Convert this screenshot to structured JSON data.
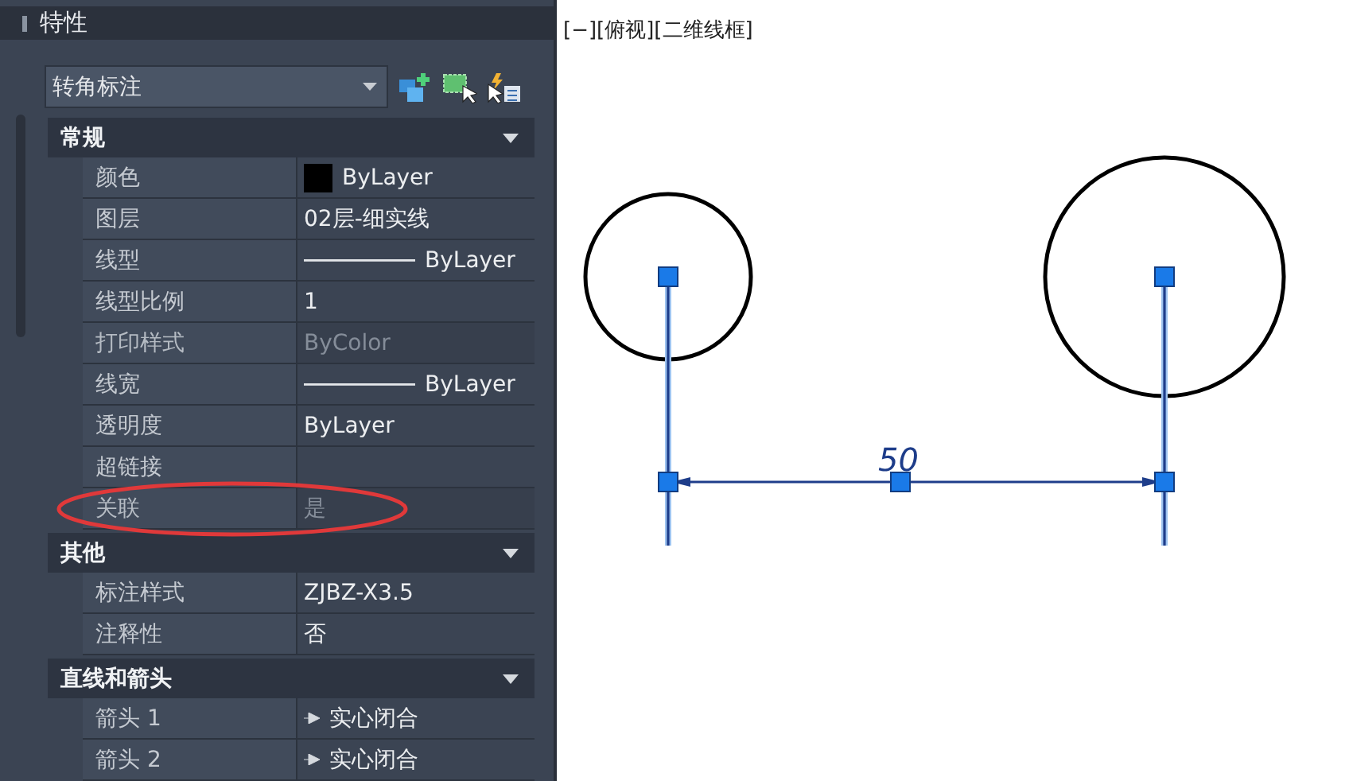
{
  "panel": {
    "title": "特性",
    "selector": {
      "value": "转角标注"
    },
    "sections": [
      {
        "title": "常规",
        "expanded": true,
        "rows": [
          {
            "label": "颜色",
            "value": "ByLayer",
            "kind": "swatch",
            "color": "#000000",
            "disabled": false,
            "circled": false
          },
          {
            "label": "图层",
            "value": "02层-细实线",
            "kind": "text",
            "disabled": false,
            "circled": false
          },
          {
            "label": "线型",
            "value": "ByLayer",
            "kind": "line",
            "disabled": false,
            "circled": false
          },
          {
            "label": "线型比例",
            "value": "1",
            "kind": "text",
            "disabled": false,
            "circled": false
          },
          {
            "label": "打印样式",
            "value": "ByColor",
            "kind": "text",
            "disabled": true,
            "circled": false
          },
          {
            "label": "线宽",
            "value": "ByLayer",
            "kind": "line",
            "disabled": false,
            "circled": false
          },
          {
            "label": "透明度",
            "value": "ByLayer",
            "kind": "text",
            "disabled": false,
            "circled": false
          },
          {
            "label": "超链接",
            "kind": "text",
            "disabled": false,
            "circled": false
          },
          {
            "label": "关联",
            "value": "是",
            "kind": "text",
            "disabled": true,
            "circled": true
          }
        ]
      },
      {
        "title": "其他",
        "expanded": true,
        "rows": [
          {
            "label": "标注样式",
            "value": "ZJBZ-X3.5",
            "kind": "text",
            "disabled": false,
            "circled": false
          },
          {
            "label": "注释性",
            "value": "否",
            "kind": "text",
            "disabled": false,
            "circled": false
          }
        ]
      },
      {
        "title": "直线和箭头",
        "expanded": true,
        "rows": [
          {
            "label": "箭头 1",
            "value": "实心闭合",
            "kind": "arrow",
            "disabled": false,
            "circled": false
          },
          {
            "label": "箭头 2",
            "value": "实心闭合",
            "kind": "arrow",
            "disabled": false,
            "circled": false
          }
        ]
      }
    ]
  },
  "viewport": {
    "label": "[−][俯视][二维线框]",
    "dimension_text": "50"
  }
}
